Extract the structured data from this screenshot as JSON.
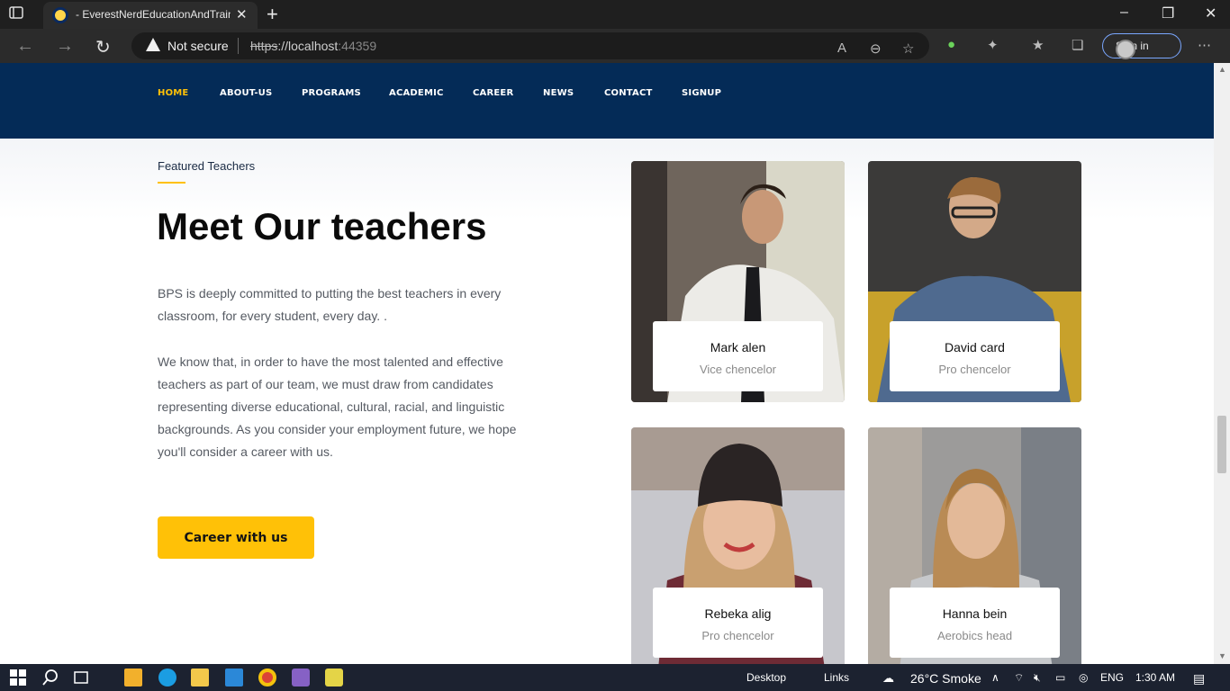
{
  "browser": {
    "tab_title": "- EverestNerdEducationAndTraining",
    "not_secure": "Not secure",
    "url_scheme": "https",
    "url_host": "://localhost",
    "url_port": ":44359",
    "signin_label": "Sign in"
  },
  "site_nav": {
    "items": [
      {
        "label": "HOME",
        "active": true
      },
      {
        "label": "ABOUT-US"
      },
      {
        "label": "PROGRAMS"
      },
      {
        "label": "ACADEMIC"
      },
      {
        "label": "CAREER"
      },
      {
        "label": "NEWS"
      },
      {
        "label": "CONTACT"
      },
      {
        "label": "SIGNUP"
      }
    ]
  },
  "teachers_section": {
    "eyebrow": "Featured Teachers",
    "heading": "Meet Our teachers",
    "para1": "BPS is deeply committed to putting the best teachers in every classroom, for every student, every day. .",
    "para2": "We know that, in order to have the most talented and effective teachers as part of our team, we must draw from candidates representing diverse educational, cultural, racial, and linguistic backgrounds. As you consider your employment future, we hope you'll consider a career with us.",
    "cta_label": "Career with us",
    "teachers": [
      {
        "name": "Mark alen",
        "role": "Vice chencelor"
      },
      {
        "name": "David card",
        "role": "Pro chencelor"
      },
      {
        "name": "Rebeka alig",
        "role": "Pro chencelor"
      },
      {
        "name": "Hanna bein",
        "role": "Aerobics head"
      }
    ]
  },
  "taskbar": {
    "desktop": "Desktop",
    "links": "Links",
    "weather": "26°C  Smoke",
    "lang": "ENG",
    "time": "1:30 AM"
  },
  "colors": {
    "nav_bg": "#042b57",
    "accent": "#ffc107"
  }
}
